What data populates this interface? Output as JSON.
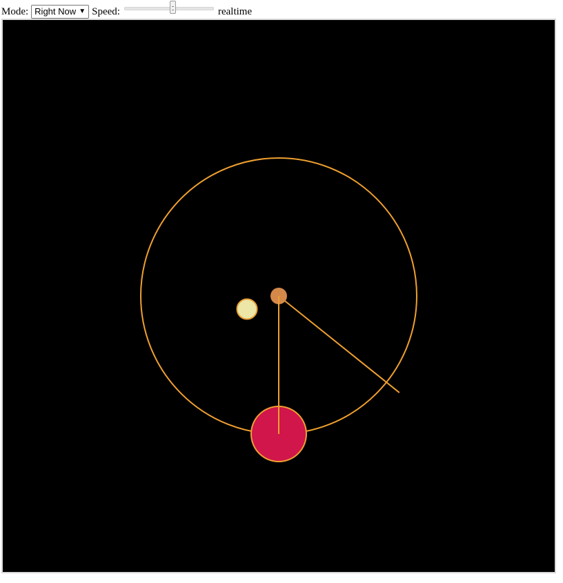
{
  "toolbar": {
    "mode_label": "Mode:",
    "mode_selected": "Right Now",
    "speed_label": "Speed:",
    "speed_value_fraction": 0.55,
    "speed_readout": "realtime"
  },
  "scene": {
    "background": "#000000",
    "orbit_color": "#f0a030",
    "center_body_color": "#d4894a",
    "moon_fill": "#ece7a6",
    "moon_stroke": "#e8a03a",
    "planet_fill": "#d0164a",
    "planet_stroke": "#f0a030",
    "hand_color": "#f0a030",
    "hand_angle_deg": 38.7
  }
}
